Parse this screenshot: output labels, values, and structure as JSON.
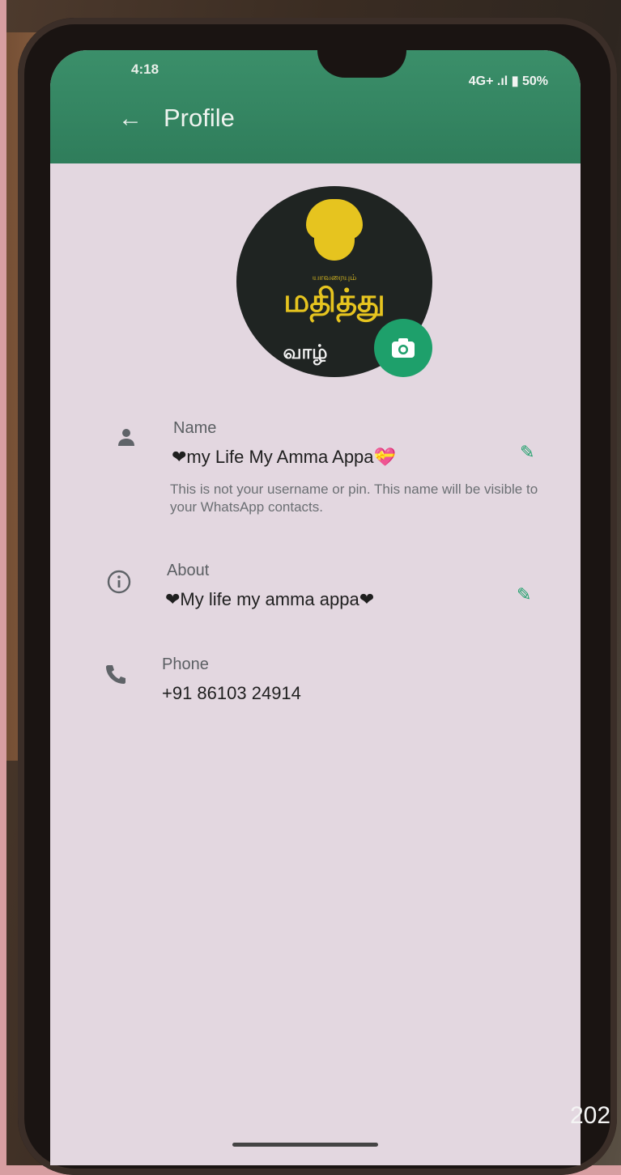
{
  "status": {
    "time": "4:18",
    "network": "4G+",
    "battery": "50%"
  },
  "appbar": {
    "title": "Profile"
  },
  "avatar": {
    "logo_small": "யாவரையும்",
    "logo_big": "மதித்து",
    "logo_mid": "வாழ்"
  },
  "name": {
    "label": "Name",
    "value": "❤my Life My Amma Appa💝",
    "hint": "This is not your username or pin. This name will be visible to your WhatsApp contacts."
  },
  "about": {
    "label": "About",
    "value": "❤My life my amma appa❤"
  },
  "phone": {
    "label": "Phone",
    "value": "+91 86103 24914"
  },
  "overlay": {
    "stamp": "202"
  },
  "icons": [
    "back-arrow-icon",
    "camera-icon",
    "person-icon",
    "info-icon",
    "phone-icon",
    "pencil-icon"
  ],
  "colors": {
    "appbar": "#2f7d5b",
    "accent": "#1ea06b",
    "background": "#e3d7e0"
  }
}
